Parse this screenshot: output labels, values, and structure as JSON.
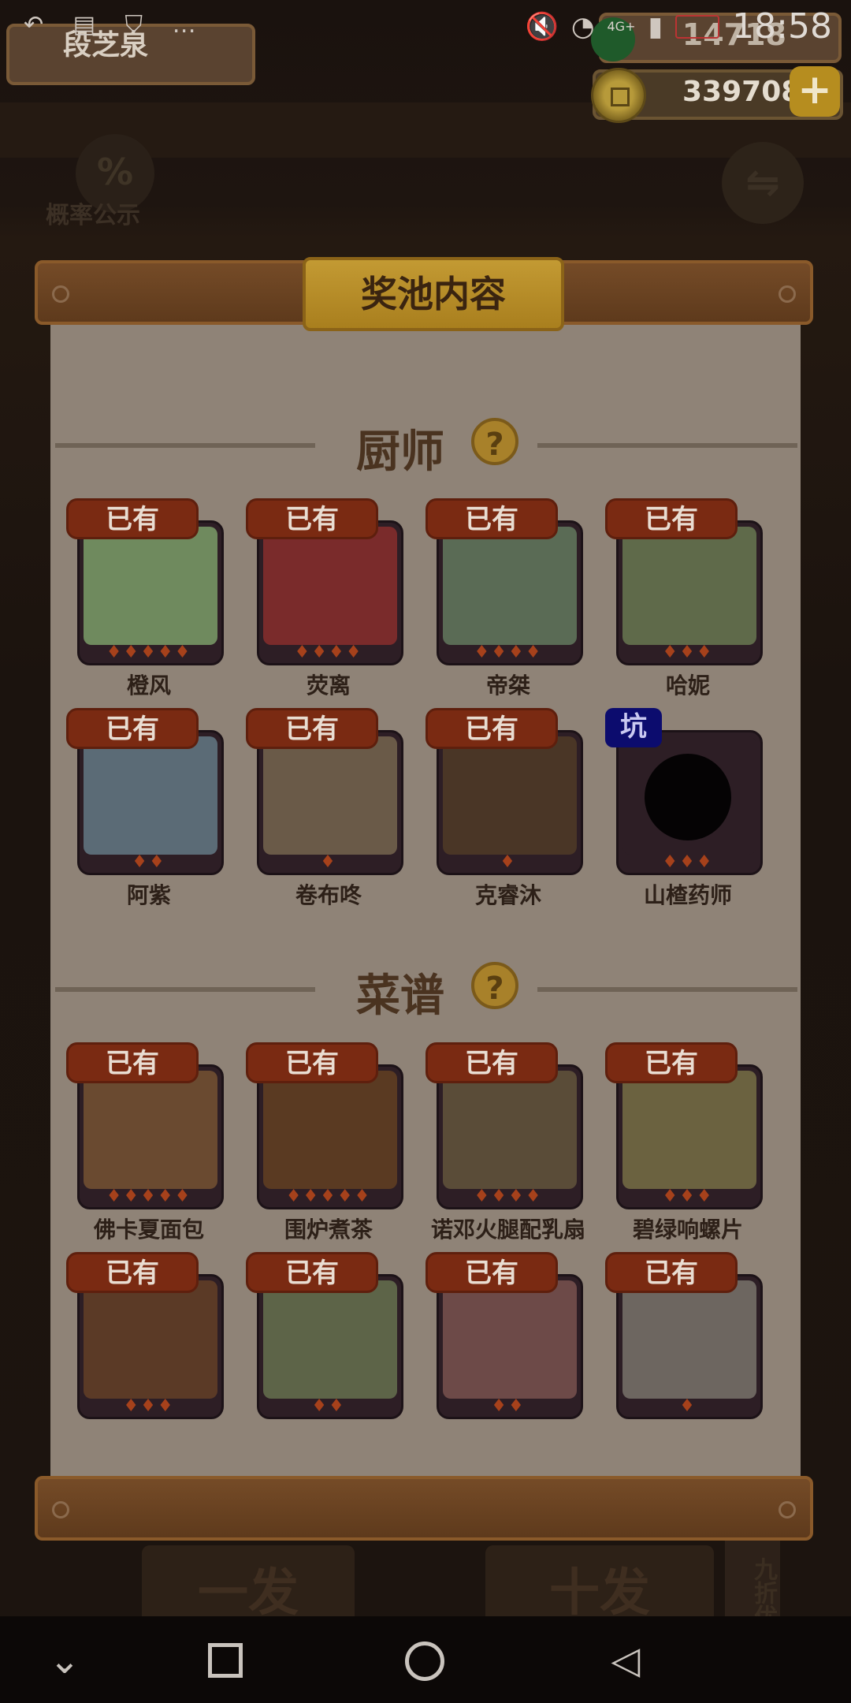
{
  "status_bar": {
    "time": "18:58",
    "left_icons": [
      "back-arrow-icon",
      "message-icon",
      "shield-icon",
      "more-icon"
    ],
    "right_icons": [
      "mute-icon",
      "wifi-icon",
      "signal-icon",
      "battery-icon"
    ],
    "network_label": "4G+"
  },
  "player": {
    "name": "段芝泉",
    "gems": "14718",
    "coins": "339708"
  },
  "background": {
    "probability_label": "概率公示",
    "single_draw": "一发",
    "ten_draw": "十发",
    "discount": "九折优惠"
  },
  "panel": {
    "title": "奖池内容",
    "chef_section": {
      "title": "厨师",
      "items": [
        {
          "name": "橙风",
          "badge": "已有",
          "stars": 5,
          "color": "#6f8a5e"
        },
        {
          "name": "荧离",
          "badge": "已有",
          "stars": 4,
          "color": "#7a2b2b"
        },
        {
          "name": "帝桀",
          "badge": "已有",
          "stars": 4,
          "color": "#5a6b55"
        },
        {
          "name": "哈妮",
          "badge": "已有",
          "stars": 3,
          "color": "#5f6a4a"
        },
        {
          "name": "阿紫",
          "badge": "已有",
          "stars": 2,
          "color": "#5b6b76"
        },
        {
          "name": "卷布咚",
          "badge": "已有",
          "stars": 1,
          "color": "#6a5a48"
        },
        {
          "name": "克睿沐",
          "badge": "已有",
          "stars": 1,
          "color": "#4a3626"
        },
        {
          "name": "山楂药师",
          "badge": "坑",
          "stars": 3,
          "color": "#2d1e25"
        }
      ]
    },
    "recipe_section": {
      "title": "菜谱",
      "items": [
        {
          "name": "佛卡夏面包",
          "badge": "已有",
          "stars": 5,
          "color": "#6a4a30"
        },
        {
          "name": "围炉煮茶",
          "badge": "已有",
          "stars": 5,
          "color": "#5a3a22"
        },
        {
          "name": "诺邓火腿配乳扇",
          "badge": "已有",
          "stars": 4,
          "color": "#5a4c38"
        },
        {
          "name": "碧绿响螺片",
          "badge": "已有",
          "stars": 3,
          "color": "#6b6240"
        },
        {
          "name": "",
          "badge": "已有",
          "stars": 3,
          "color": "#5b3a26"
        },
        {
          "name": "",
          "badge": "已有",
          "stars": 2,
          "color": "#5d6448"
        },
        {
          "name": "",
          "badge": "已有",
          "stars": 2,
          "color": "#6d4a48"
        },
        {
          "name": "",
          "badge": "已有",
          "stars": 1,
          "color": "#6d6660"
        }
      ]
    }
  },
  "nav_bar": {
    "icons": [
      "chevron-down-icon",
      "recents-icon",
      "home-icon",
      "back-icon"
    ]
  }
}
